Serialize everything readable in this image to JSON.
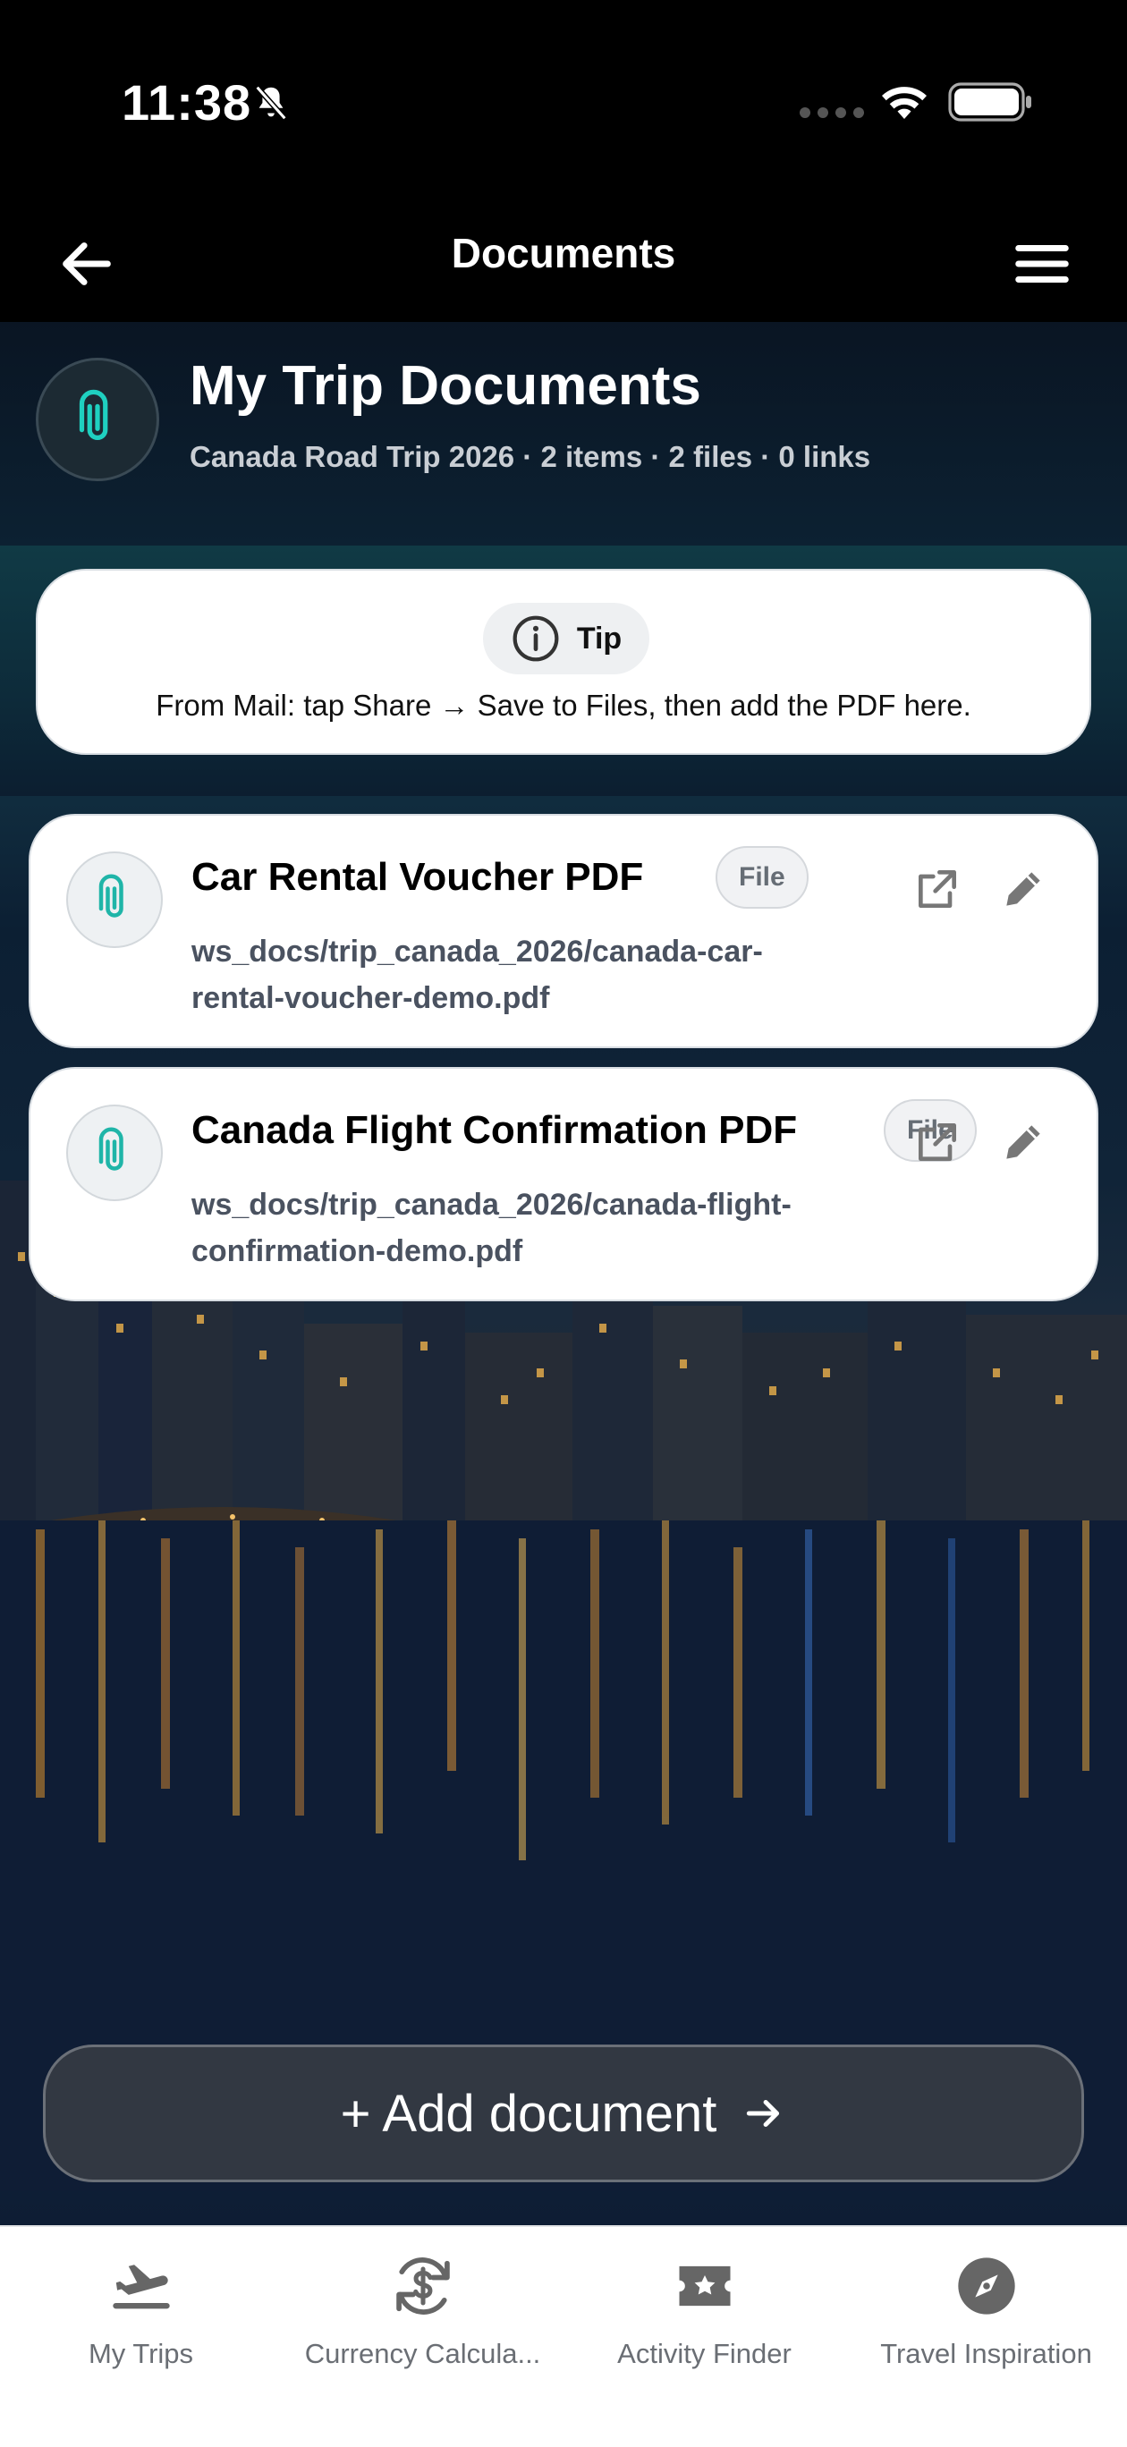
{
  "status_bar": {
    "time": "11:38"
  },
  "nav": {
    "title": "Documents",
    "back_icon": "arrow-left-icon",
    "menu_icon": "hamburger-menu-icon"
  },
  "header": {
    "icon": "paperclip-icon",
    "title": "My Trip Documents",
    "subtitle": "Canada Road Trip 2026 · 2 items · 2 files · 0 links"
  },
  "tip": {
    "icon": "info-icon",
    "label": "Tip",
    "text": "From Mail: tap Share → Save to Files, then add the PDF here."
  },
  "documents": [
    {
      "title": "Car Rental Voucher PDF",
      "badge": "File",
      "path_line1": "ws_docs/trip_canada_2026/canada-car-",
      "path_line2": "rental-voucher-demo.pdf"
    },
    {
      "title": "Canada Flight Confirmation PDF",
      "badge": "File",
      "path_line1": "ws_docs/trip_canada_2026/canada-flight-",
      "path_line2": "confirmation-demo.pdf"
    }
  ],
  "add_button": {
    "label": "+ Add document"
  },
  "tabs": [
    {
      "label": "My Trips",
      "icon": "airplane-departure-icon"
    },
    {
      "label": "Currency Calcula...",
      "icon": "currency-exchange-icon"
    },
    {
      "label": "Activity Finder",
      "icon": "ticket-star-icon"
    },
    {
      "label": "Travel Inspiration",
      "icon": "compass-icon"
    }
  ],
  "colors": {
    "accent": "#1fb5a8",
    "card_bg": "#ffffff",
    "status_bg": "#000000"
  }
}
